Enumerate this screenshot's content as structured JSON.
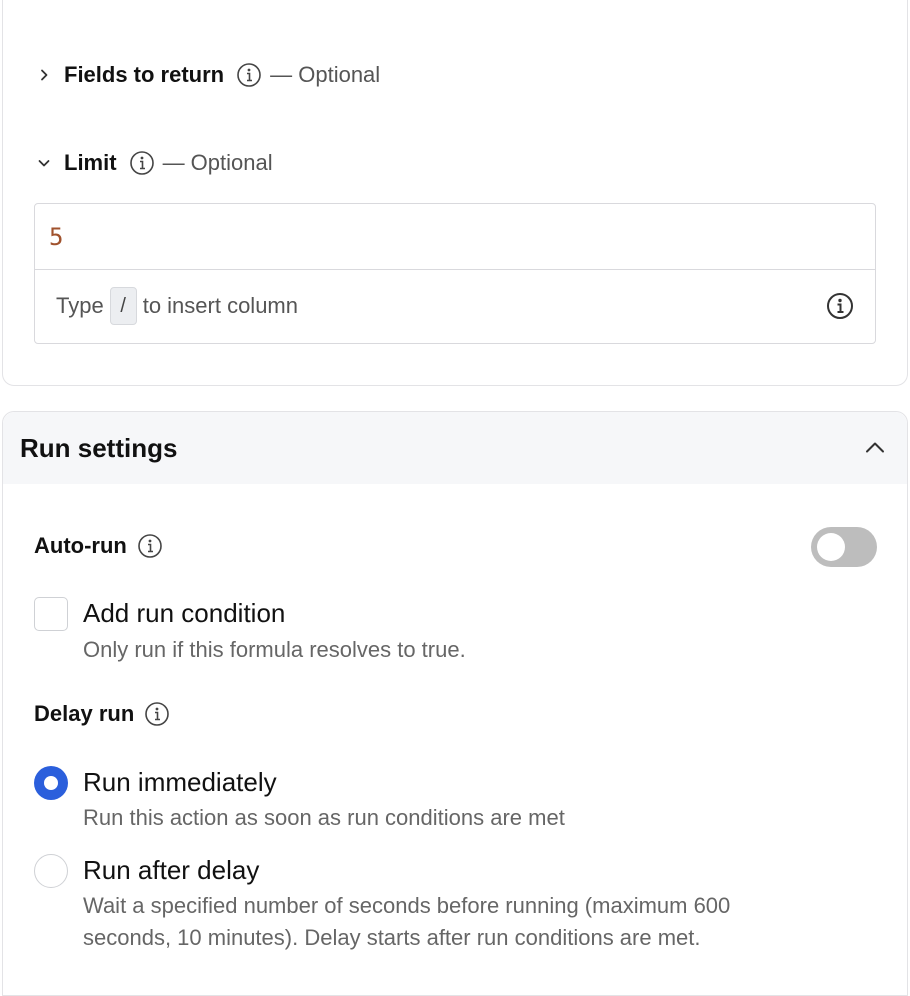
{
  "query_section": {
    "fields_to_return": {
      "label": "Fields to return",
      "optional": "— Optional",
      "expanded": false
    },
    "limit": {
      "label": "Limit",
      "optional": "— Optional",
      "expanded": true,
      "value": "5",
      "hint_prefix": "Type",
      "hint_key": "/",
      "hint_suffix": "to insert column"
    }
  },
  "run_settings": {
    "title": "Run settings",
    "auto_run": {
      "label": "Auto-run",
      "enabled": false
    },
    "run_condition": {
      "label": "Add run condition",
      "description": "Only run if this formula resolves to true.",
      "checked": false
    },
    "delay_run": {
      "label": "Delay run",
      "options": [
        {
          "label": "Run immediately",
          "description": "Run this action as soon as run conditions are met",
          "selected": true
        },
        {
          "label": "Run after delay",
          "description": "Wait a specified number of seconds before running (maximum 600",
          "description_line2": "seconds, 10 minutes). Delay starts after run conditions are met.",
          "selected": false
        }
      ]
    }
  },
  "colors": {
    "accent": "#2b5fdc",
    "limit_value": "#a0522d",
    "toggle_off": "#bdbdbd"
  },
  "icons": [
    "chevron-right-icon",
    "chevron-down-icon",
    "info-icon",
    "chevron-up-icon"
  ]
}
